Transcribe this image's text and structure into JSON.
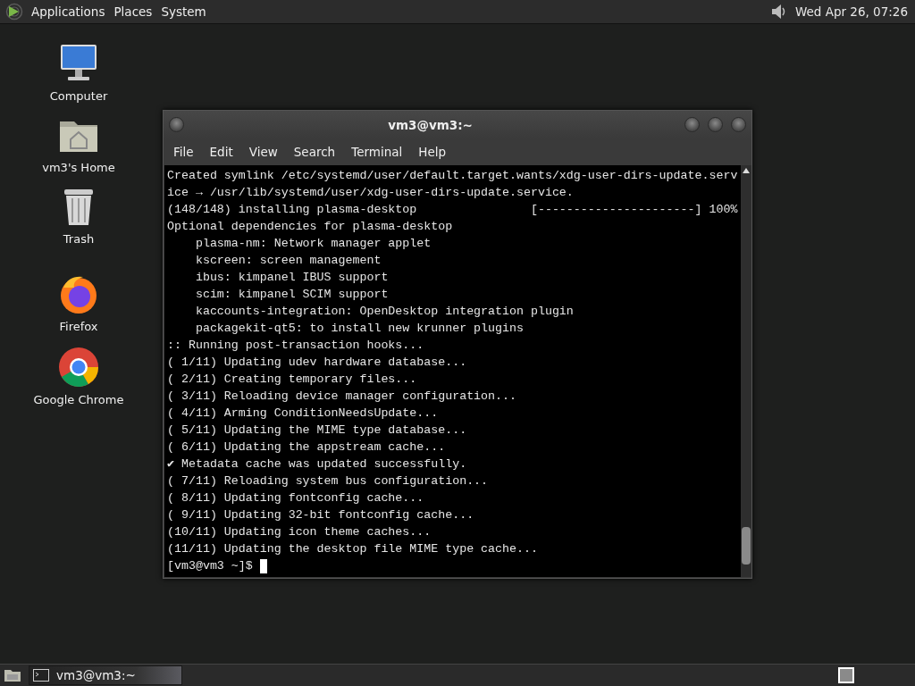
{
  "top_panel": {
    "menus": [
      "Applications",
      "Places",
      "System"
    ],
    "clock": "Wed Apr 26, 07:26"
  },
  "desktop_icons": [
    {
      "label": "Computer",
      "kind": "computer"
    },
    {
      "label": "vm3's Home",
      "kind": "home"
    },
    {
      "label": "Trash",
      "kind": "trash"
    },
    {
      "label": "Firefox",
      "kind": "firefox"
    },
    {
      "label": "Google Chrome",
      "kind": "chrome"
    }
  ],
  "terminal_window": {
    "title": "vm3@vm3:~",
    "menus": [
      "File",
      "Edit",
      "View",
      "Search",
      "Terminal",
      "Help"
    ],
    "lines": [
      "Created symlink /etc/systemd/user/default.target.wants/xdg-user-dirs-update.serv",
      "ice → /usr/lib/systemd/user/xdg-user-dirs-update.service.",
      "(148/148) installing plasma-desktop                [----------------------] 100%",
      "Optional dependencies for plasma-desktop",
      "    plasma-nm: Network manager applet",
      "    kscreen: screen management",
      "    ibus: kimpanel IBUS support",
      "    scim: kimpanel SCIM support",
      "    kaccounts-integration: OpenDesktop integration plugin",
      "    packagekit-qt5: to install new krunner plugins",
      ":: Running post-transaction hooks...",
      "( 1/11) Updating udev hardware database...",
      "( 2/11) Creating temporary files...",
      "( 3/11) Reloading device manager configuration...",
      "( 4/11) Arming ConditionNeedsUpdate...",
      "( 5/11) Updating the MIME type database...",
      "( 6/11) Updating the appstream cache...",
      "✔ Metadata cache was updated successfully.",
      "( 7/11) Reloading system bus configuration...",
      "( 8/11) Updating fontconfig cache...",
      "( 9/11) Updating 32-bit fontconfig cache...",
      "(10/11) Updating icon theme caches...",
      "(11/11) Updating the desktop file MIME type cache..."
    ],
    "prompt": "[vm3@vm3 ~]$"
  },
  "taskbar": {
    "tasks": [
      {
        "label": "vm3@vm3:~",
        "selected": true
      }
    ]
  }
}
